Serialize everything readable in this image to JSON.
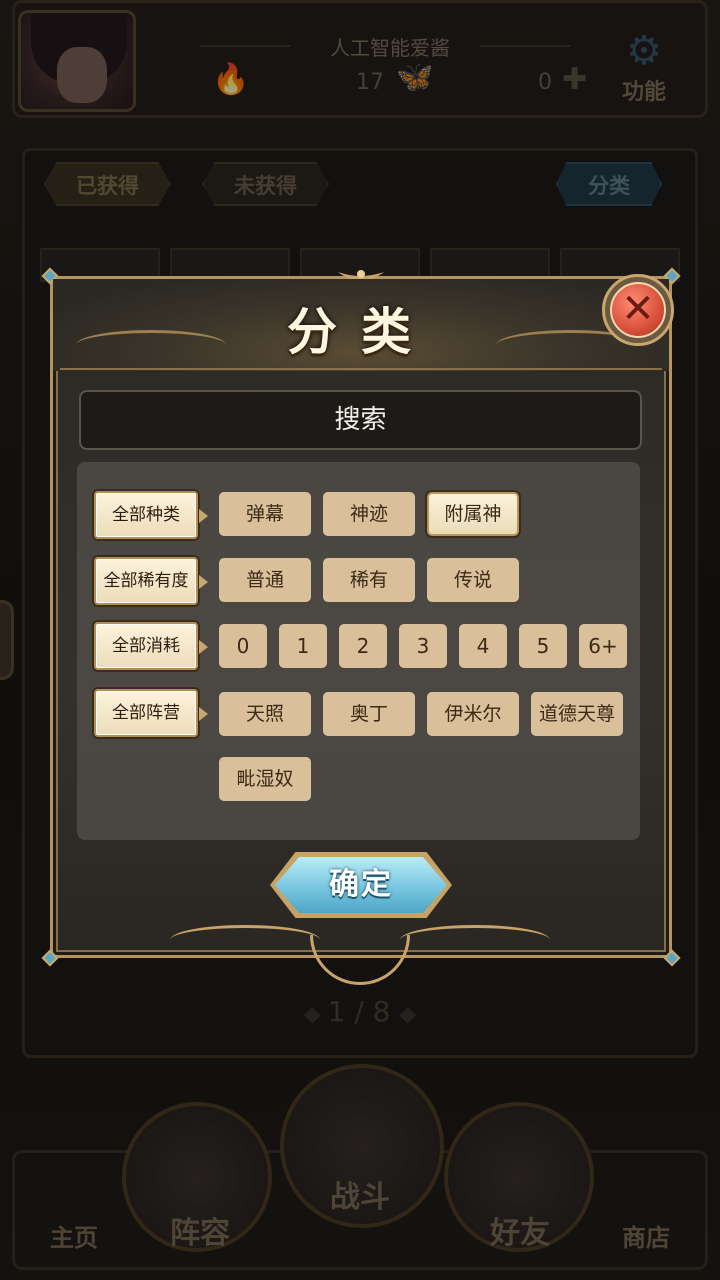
{
  "header": {
    "player_name": "人工智能爱酱",
    "resource_1": "17",
    "resource_2": "0",
    "function_label": "功能"
  },
  "tabs": {
    "owned": "已获得",
    "not_owned": "未获得",
    "classify": "分类"
  },
  "pager": {
    "text": "1 / 8"
  },
  "bottom_nav": {
    "home": "主页",
    "lineup": "阵容",
    "battle": "战斗",
    "friends": "好友",
    "shop": "商店"
  },
  "modal": {
    "title": "分类",
    "close_symbol": "✕",
    "search_label": "搜索",
    "rows": {
      "type": {
        "label": "全部种类",
        "options": [
          "弹幕",
          "神迹",
          "附属神"
        ],
        "selected": "附属神"
      },
      "rarity": {
        "label": "全部稀有度",
        "options": [
          "普通",
          "稀有",
          "传说"
        ]
      },
      "cost": {
        "label": "全部消耗",
        "options": [
          "0",
          "1",
          "2",
          "3",
          "4",
          "5",
          "6+"
        ]
      },
      "faction": {
        "label": "全部阵营",
        "options": [
          "天照",
          "奥丁",
          "伊米尔",
          "道德天尊",
          "毗湿奴"
        ]
      }
    },
    "confirm_label": "确定"
  },
  "colors": {
    "chip": "#d9c09a",
    "frame_gold": "#b59462",
    "confirm_blue": "#78c6df",
    "close_red": "#d8503a"
  }
}
